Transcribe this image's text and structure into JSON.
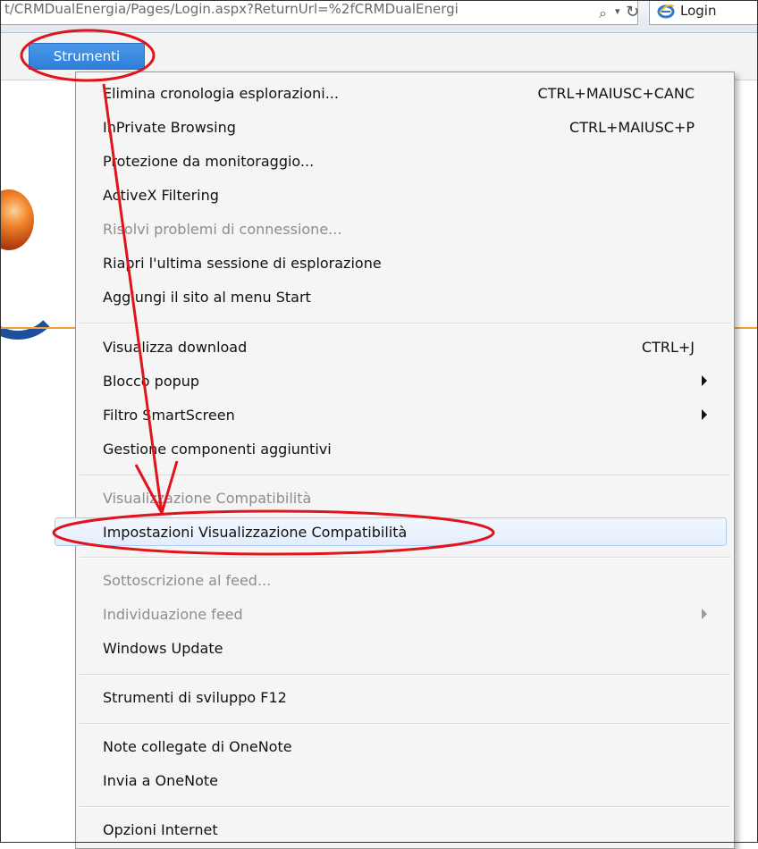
{
  "addressbar": {
    "url_text": "t/CRMDualEnergia/Pages/Login.aspx?ReturnUrl=%2fCRMDualEnergi",
    "tab_label": "Login"
  },
  "menubar": {
    "strumenti_label": "Strumenti"
  },
  "menu": {
    "items": [
      {
        "label": "Elimina cronologia esplorazioni...",
        "shortcut": "CTRL+MAIUSC+CANC"
      },
      {
        "label": "InPrivate Browsing",
        "shortcut": "CTRL+MAIUSC+P"
      },
      {
        "label": "Protezione da monitoraggio...",
        "shortcut": ""
      },
      {
        "label": "ActiveX Filtering",
        "shortcut": ""
      },
      {
        "label": "Risolvi problemi di connessione...",
        "shortcut": ""
      },
      {
        "label": "Riapri l'ultima sessione di esplorazione",
        "shortcut": ""
      },
      {
        "label": "Aggiungi il sito al menu Start",
        "shortcut": ""
      },
      {
        "label": "Visualizza download",
        "shortcut": "CTRL+J"
      },
      {
        "label": "Blocco popup",
        "shortcut": ""
      },
      {
        "label": "Filtro SmartScreen",
        "shortcut": ""
      },
      {
        "label": "Gestione componenti aggiuntivi",
        "shortcut": ""
      },
      {
        "label": "Visualizzazione Compatibilità",
        "shortcut": ""
      },
      {
        "label": "Impostazioni Visualizzazione Compatibilità",
        "shortcut": ""
      },
      {
        "label": "Sottoscrizione al feed...",
        "shortcut": ""
      },
      {
        "label": "Individuazione feed",
        "shortcut": ""
      },
      {
        "label": "Windows Update",
        "shortcut": ""
      },
      {
        "label": "Strumenti di sviluppo F12",
        "shortcut": ""
      },
      {
        "label": "Note collegate di OneNote",
        "shortcut": ""
      },
      {
        "label": "Invia a OneNote",
        "shortcut": ""
      },
      {
        "label": "Opzioni Internet",
        "shortcut": ""
      }
    ]
  },
  "colors": {
    "annotation_red": "#e0141b",
    "menu_highlight": "#aecbf0",
    "strumenti_blue": "#3a89e0"
  }
}
